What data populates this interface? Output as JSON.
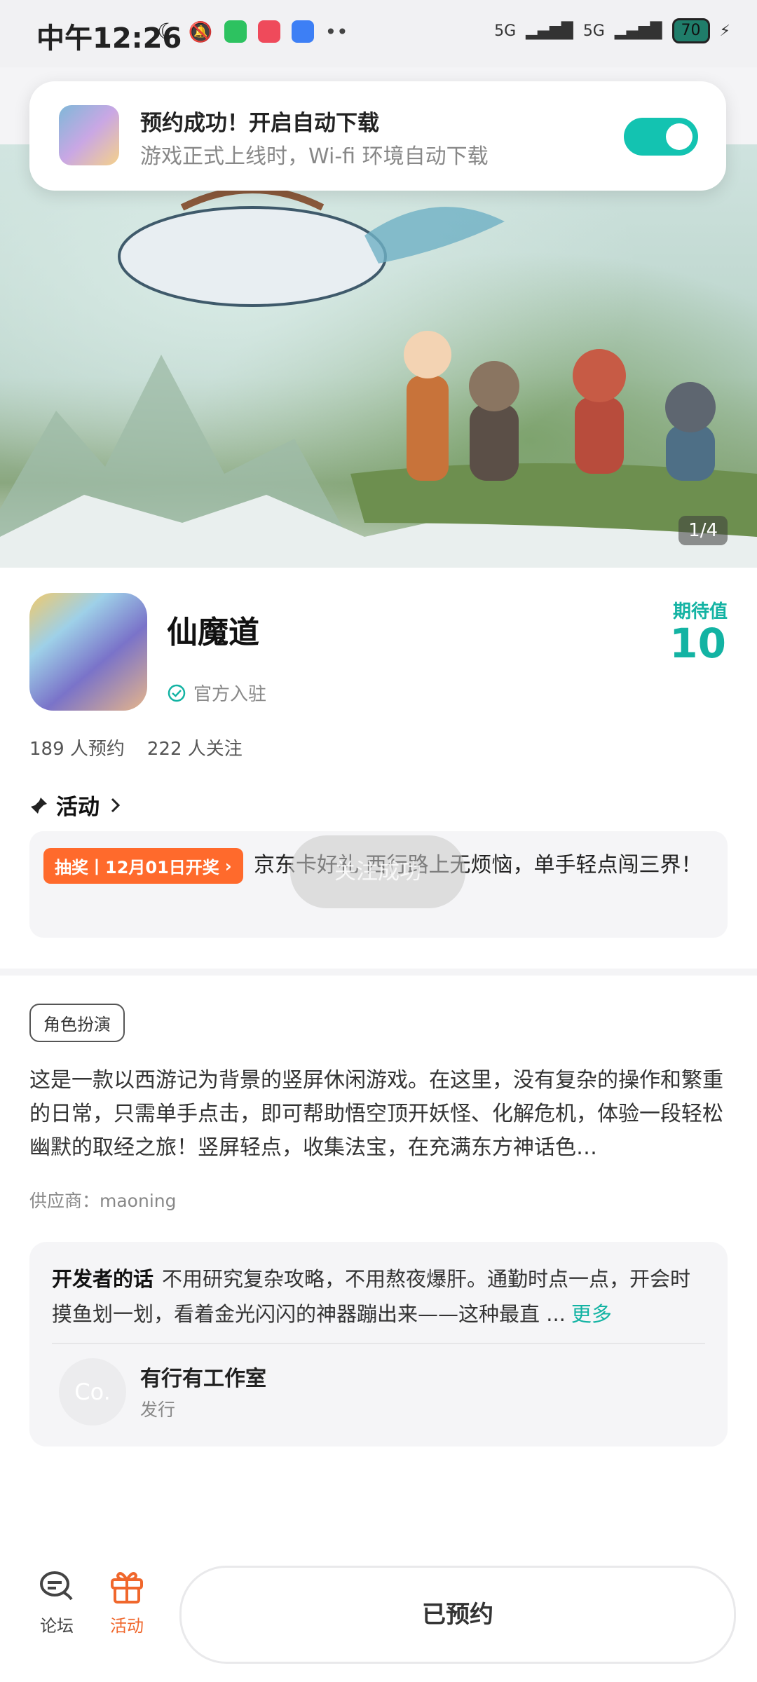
{
  "status_bar": {
    "time": "中午12:26",
    "network_1": "5G",
    "network_2": "5G",
    "battery": "70"
  },
  "notification": {
    "title": "预约成功！开启自动下载",
    "subtitle": "游戏正式上线时，Wi-fi 环境自动下载",
    "toggle_on": true,
    "accent_color": "#13c3b1"
  },
  "banner": {
    "counter": "1/4"
  },
  "game": {
    "name": "仙魔道",
    "official_label": "官方入驻",
    "expect_label": "期待值",
    "expect_value": "10",
    "reserve_count": "189 人预约",
    "follow_count": "222 人关注"
  },
  "activity": {
    "heading": "活动",
    "badge": "抽奖丨12月01日开奖",
    "text": "京东卡好礼 西行路上无烦恼，单手轻点闯三界！",
    "toast": "关注成功"
  },
  "description": {
    "tag": "角色扮演",
    "text": "这是一款以西游记为背景的竖屏休闲游戏。在这里，没有复杂的操作和繁重的日常，只需单手点击，即可帮助悟空顶开妖怪、化解危机，体验一段轻松幽默的取经之旅！竖屏轻点，收集法宝，在充满东方神话色…",
    "supplier": "供应商：maoning"
  },
  "developer": {
    "title": "开发者的话",
    "text": "不用研究复杂攻略，不用熬夜爆肝。通勤时点一点，开会时摸鱼划一划，看着金光闪闪的神器蹦出来——这种最直 ...",
    "more": "更多",
    "avatar_text": "Co.",
    "studio_name": "有行有工作室",
    "studio_role": "发行"
  },
  "bottom_bar": {
    "forum_label": "论坛",
    "activity_label": "活动",
    "reserved_label": "已预约",
    "active_color": "#f0672c"
  }
}
